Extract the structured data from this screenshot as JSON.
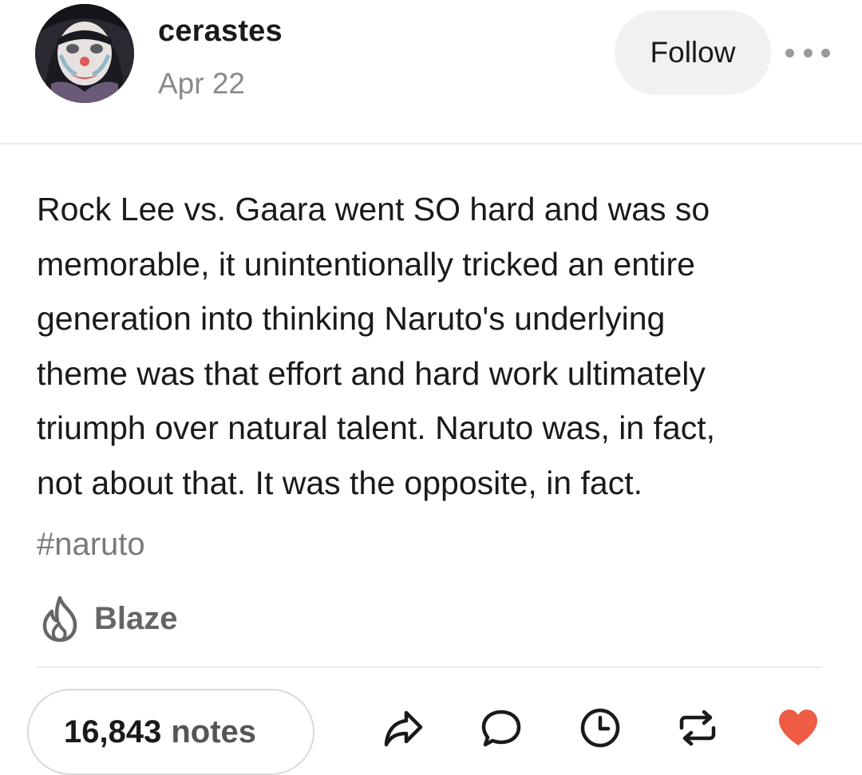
{
  "post": {
    "username": "cerastes",
    "date": "Apr 22",
    "follow_label": "Follow",
    "more_icon": "more-horizontal-icon",
    "body_lines": [
      "Rock Lee vs. Gaara went SO hard and was so",
      "memorable, it unintentionally tricked an entire",
      "generation into thinking Naruto's underlying",
      "theme was that effort and hard work ultimately",
      "triumph over natural talent. Naruto was, in fact,",
      "not about that. It was the opposite, in fact."
    ],
    "tag": "#naruto",
    "blaze_label": "Blaze"
  },
  "footer": {
    "notes_count": "16,843",
    "notes_label": "notes",
    "actions": [
      "share-icon",
      "reply-icon",
      "clock-icon",
      "reblog-icon",
      "heart-icon"
    ]
  },
  "colors": {
    "text": "#1a1a1a",
    "muted": "#8a8a8a",
    "follow_bg": "#f0f1f3",
    "like": "#ee5c45"
  }
}
